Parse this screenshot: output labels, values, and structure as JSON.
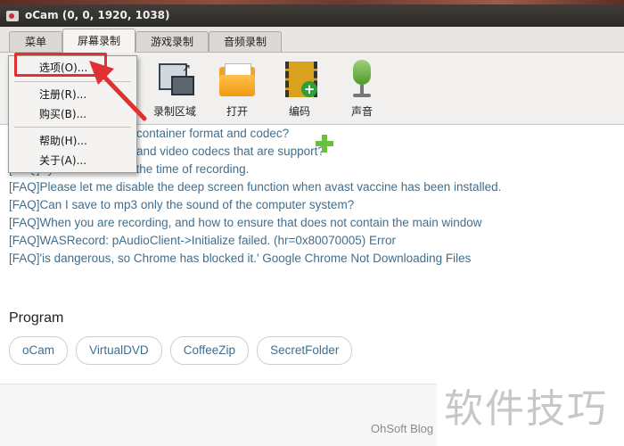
{
  "window": {
    "title": "oCam (0, 0, 1920, 1038)"
  },
  "tabs": [
    {
      "label": "菜单"
    },
    {
      "label": "屏幕录制"
    },
    {
      "label": "游戏录制"
    },
    {
      "label": "音频录制"
    }
  ],
  "toolbar": [
    {
      "label": "录制区域",
      "icon": "record-region-icon"
    },
    {
      "label": "打开",
      "icon": "folder-icon"
    },
    {
      "label": "编码",
      "icon": "film-encode-icon"
    },
    {
      "label": "声音",
      "icon": "microphone-icon"
    }
  ],
  "menu": {
    "items": [
      {
        "label": "选项(O)..."
      },
      {
        "label": "注册(R)..."
      },
      {
        "label": "购买(B)..."
      },
      {
        "label": "帮助(H)..."
      },
      {
        "label": "关于(A)..."
      }
    ]
  },
  "faq": [
    "container format and codec?",
    "and video codecs that are support?",
    "[FAQ]System is slow at the time of recording.",
    "[FAQ]Please let me disable the deep screen function when avast vaccine has been installed.",
    "[FAQ]Can I save to mp3 only the sound of the computer system?",
    "[FAQ]When you are recording, and how to ensure that does not contain the main window",
    "[FAQ]WASRecord: pAudioClient->Initialize failed. (hr=0x80070005) Error",
    "[FAQ]'is dangerous, so Chrome has blocked it.' Google Chrome Not Downloading Files"
  ],
  "program": {
    "heading": "Program",
    "items": [
      "oCam",
      "VirtualDVD",
      "CoffeeZip",
      "SecretFolder"
    ]
  },
  "footer": {
    "blog": "OhSoft Blog"
  },
  "watermark": "软件技巧",
  "colors": {
    "link": "#3f6f8f",
    "highlight": "#e03030",
    "menu_bg": "#f4f3f1"
  }
}
